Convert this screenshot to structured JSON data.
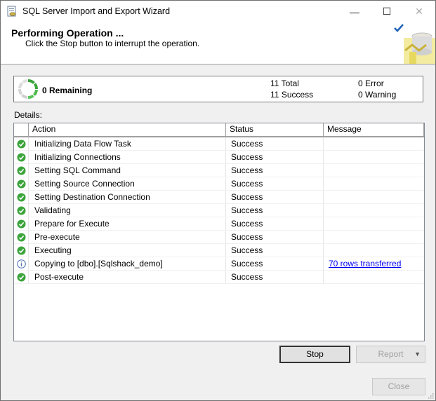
{
  "window": {
    "title": "SQL Server Import and Export Wizard"
  },
  "titlebar_buttons": {
    "minimize": "—",
    "maximize": "☐",
    "close": "✕"
  },
  "header": {
    "title": "Performing Operation ...",
    "subtitle": "Click the Stop button to interrupt the operation."
  },
  "summary": {
    "remaining": "0 Remaining",
    "total_count": "11",
    "total_label": "Total",
    "success_count": "11",
    "success_label": "Success",
    "error_count": "0",
    "error_label": "Error",
    "warning_count": "0",
    "warning_label": "Warning"
  },
  "details_label": "Details:",
  "table": {
    "headers": [
      "Action",
      "Status",
      "Message"
    ],
    "rows": [
      {
        "icon": "success-icon",
        "action": "Initializing Data Flow Task",
        "status": "Success",
        "message": ""
      },
      {
        "icon": "success-icon",
        "action": "Initializing Connections",
        "status": "Success",
        "message": ""
      },
      {
        "icon": "success-icon",
        "action": "Setting SQL Command",
        "status": "Success",
        "message": ""
      },
      {
        "icon": "success-icon",
        "action": "Setting Source Connection",
        "status": "Success",
        "message": ""
      },
      {
        "icon": "success-icon",
        "action": "Setting Destination Connection",
        "status": "Success",
        "message": ""
      },
      {
        "icon": "success-icon",
        "action": "Validating",
        "status": "Success",
        "message": ""
      },
      {
        "icon": "success-icon",
        "action": "Prepare for Execute",
        "status": "Success",
        "message": ""
      },
      {
        "icon": "success-icon",
        "action": "Pre-execute",
        "status": "Success",
        "message": ""
      },
      {
        "icon": "success-icon",
        "action": "Executing",
        "status": "Success",
        "message": ""
      },
      {
        "icon": "info-icon",
        "action": "Copying to [dbo].[Sqlshack_demo]",
        "status": "Success",
        "message": "70 rows transferred"
      },
      {
        "icon": "success-icon",
        "action": "Post-execute",
        "status": "Success",
        "message": ""
      }
    ]
  },
  "buttons": {
    "stop": "Stop",
    "report": "Report",
    "report_arrow": "▼",
    "close": "Close"
  },
  "colors": {
    "success_green": "#3aa43a",
    "info_blue": "#4a6fb5",
    "link": "#0000ee"
  }
}
